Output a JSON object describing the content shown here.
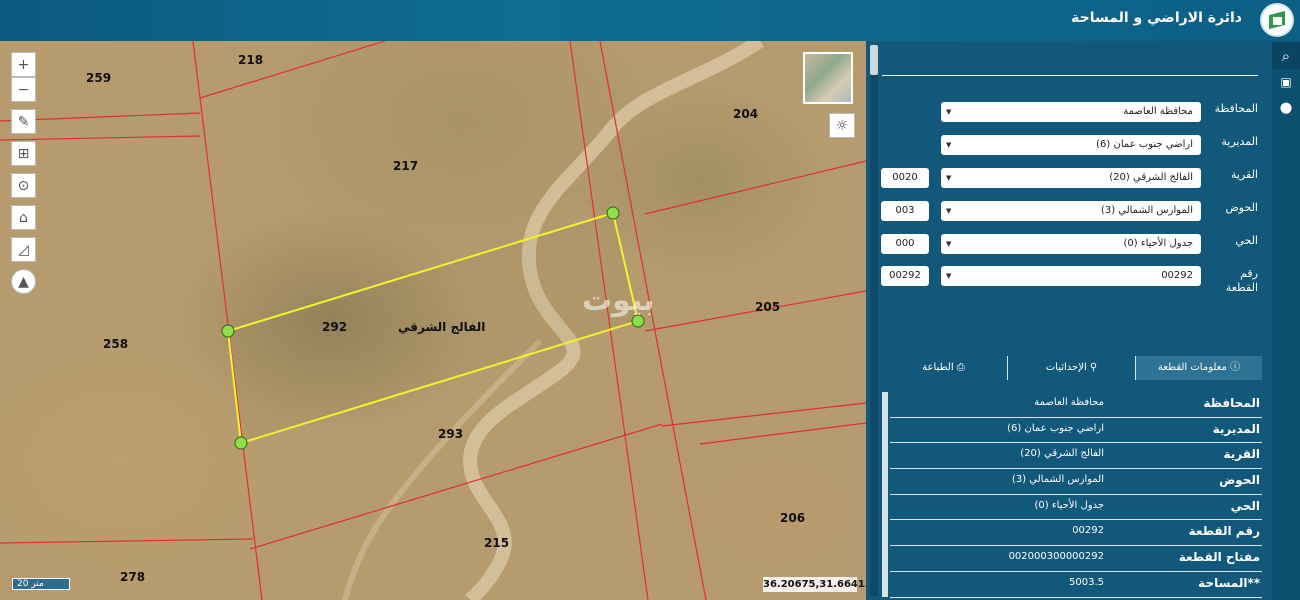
{
  "header": {
    "title": "دائرة الاراضي و المساحة",
    "logo": "dls-logo"
  },
  "map": {
    "parcels": [
      {
        "label": "218"
      },
      {
        "label": "259"
      },
      {
        "label": "217"
      },
      {
        "label": "204"
      },
      {
        "label": "292"
      },
      {
        "label": "205"
      },
      {
        "label": "258"
      },
      {
        "label": "293"
      },
      {
        "label": "206"
      },
      {
        "label": "215"
      },
      {
        "label": "278"
      }
    ],
    "village_label": "الفالج الشرقي",
    "watermark": "بيوت",
    "scale": "20 متر",
    "coordinates": "36.20675,31.66413",
    "tools": [
      "zoom-in-icon",
      "zoom-out-icon",
      "draw-icon",
      "measure-icon",
      "locate-icon",
      "home-icon",
      "area-icon",
      "compass-icon"
    ],
    "tool_glyphs": [
      "+",
      "−",
      "✎",
      "⊞",
      "⊙",
      "⌂",
      "◿",
      "▲"
    ],
    "sun_glyph": "☼",
    "colors": {
      "selected_parcel": "#f2f22e",
      "boundaries": "#e03030",
      "vertex": "#8ee04a"
    }
  },
  "form": {
    "fields": [
      {
        "label": "المحافظة",
        "value": "محافظة العاصمة",
        "code": ""
      },
      {
        "label": "المديرية",
        "value": "اراضي جنوب عمان (6)",
        "code": ""
      },
      {
        "label": "القرية",
        "value": "الفالج الشرقي (20)",
        "code": "0020"
      },
      {
        "label": "الحوض",
        "value": "الموارس الشمالي (3)",
        "code": "003"
      },
      {
        "label": "الحي",
        "value": "جدول الأحياء (0)",
        "code": "000"
      },
      {
        "label": "رقم القطعة",
        "value": "00292",
        "code": "00292"
      }
    ],
    "caret": "▼"
  },
  "tabs": [
    {
      "label": "الطباعة",
      "icon": "printer-icon"
    },
    {
      "label": "الإحداثيات",
      "icon": "location-pin-icon"
    },
    {
      "label": "معلومات القطعة",
      "icon": "info-icon",
      "active": true
    }
  ],
  "info": [
    {
      "key": "المحافظة",
      "value": "محافظة العاصمة"
    },
    {
      "key": "المديرية",
      "value": "اراضي جنوب عمان (6)"
    },
    {
      "key": "القرية",
      "value": "الفالج الشرقي (20)"
    },
    {
      "key": "الحوض",
      "value": "الموارس الشمالي (3)"
    },
    {
      "key": "الحي",
      "value": "جدول الأحياء (0)"
    },
    {
      "key": "رقم القطعة",
      "value": "00292"
    },
    {
      "key": "مفتاح القطعة",
      "value": "002000300000292"
    },
    {
      "key": "**المساحة",
      "value": "5003.5"
    }
  ],
  "sidebar_icons": [
    {
      "name": "search-icon",
      "glyph": "⌕"
    },
    {
      "name": "layers-icon",
      "glyph": "▣"
    },
    {
      "name": "location-pin-icon",
      "glyph": "⬤"
    }
  ]
}
